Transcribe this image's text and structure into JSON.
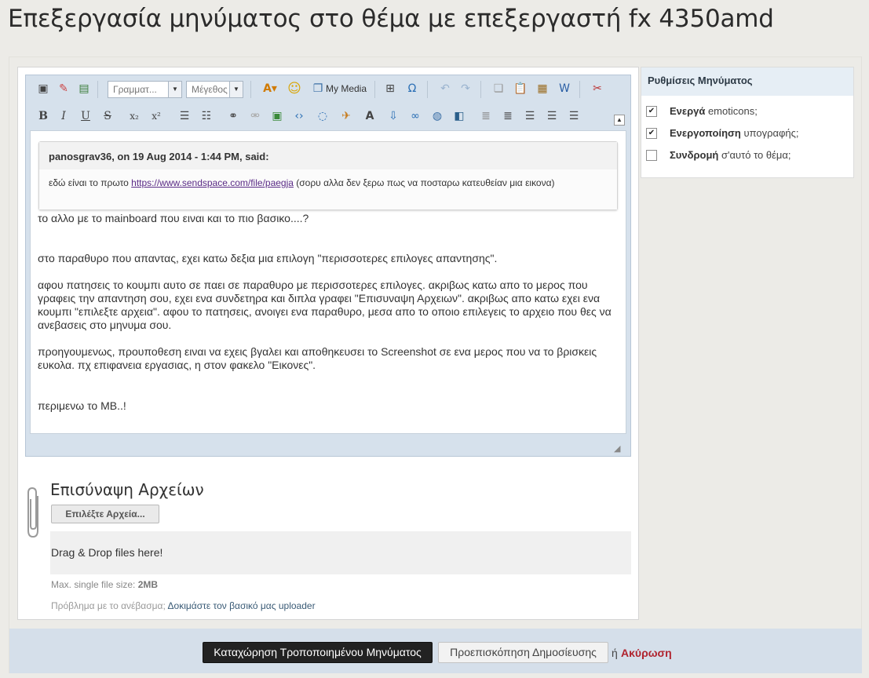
{
  "page": {
    "title": "Επεξεργασία μηνύματος στο θέμα με επεξεργαστή fx 4350amd"
  },
  "toolbar": {
    "font_select": "Γραμματ...",
    "size_select": "Μέγεθος",
    "my_media": "My Media",
    "row1_icons": [
      "source-icon",
      "eraser-icon",
      "toggle-editor-icon",
      "font-color-icon",
      "emoticon-icon",
      "media-icon",
      "table-icon",
      "special-char-icon",
      "undo-icon",
      "redo-icon",
      "copy-icon",
      "paste-icon",
      "paste-text-icon",
      "paste-word-icon",
      "remove-format-icon"
    ],
    "row2_icons": [
      "bold-icon",
      "italic-icon",
      "underline-icon",
      "strikethrough-icon",
      "subscript-icon",
      "superscript-icon",
      "bulleted-list-icon",
      "numbered-list-icon",
      "link-icon",
      "unlink-icon",
      "image-icon",
      "code-icon",
      "quote-icon",
      "spoiler-icon",
      "font-size-icon",
      "upload-icon",
      "url-icon",
      "web-icon",
      "media-embed-icon",
      "outdent-icon",
      "indent-icon",
      "align-left-icon",
      "align-center-icon",
      "align-right-icon"
    ]
  },
  "editor": {
    "quote_header": "panosgrav36, on 19 Aug 2014 - 1:44 PM, said:",
    "quote_text_before": "εδώ είναι το πρωτο ",
    "quote_link": "https://www.sendspace.com/file/paegja",
    "quote_text_after": "      (σορυ αλλα δεν ξερω πως να ποσταρω κατευθείαν μια εικονα)",
    "paragraphs": [
      "το αλλο με το mainboard που ειναι και το πιο βασικο....?",
      "στο παραθυρο που απαντας, εχει κατω δεξια μια επιλογη \"περισσοτερες επιλογες απαντησης\".",
      "αφου πατησεις το κουμπι αυτο σε παει σε παραθυρο με περισσοτερες επιλογες. ακριβως κατω απο το μερος που γραφεις την απαντηση σου, εχει ενα συνδετηρα και διπλα γραφει \"Επισυναψη Αρχειων\". ακριβως απο κατω εχει ενα κουμπι \"επιλεξτε αρχεια\". αφου το πατησεις, ανοιγει ενα παραθυρο, μεσα απο το οποιο επιλεγεις το αρχειο που θες να ανεβασεις στο μηνυμα σου.",
      "προηγουμενως, προυποθεση ειναι να εχεις βγαλει και αποθηκευσει το Screenshot σε ενα μερος που να το βρισκεις ευκολα. πχ επιφανεια εργασιας, η στον φακελο \"Εικονες\".",
      "περιμενω το MB..!"
    ]
  },
  "attachments": {
    "title": "Επισύναψη Αρχείων",
    "choose_button": "Επιλέξτε Αρχεία...",
    "dropzone": "Drag & Drop files here!",
    "max_label": "Max. single file size: ",
    "max_value": "2MB",
    "problem_text": "Πρόβλημα με το ανέβασμα; ",
    "problem_link": "Δοκιμάστε τον βασικό μας uploader"
  },
  "sidebar": {
    "title": "Ρυθμίσεις Μηνύματος",
    "options": [
      {
        "bold": "Ενεργά",
        "rest": " emoticons;",
        "checked": true
      },
      {
        "bold": "Ενεργοποίηση",
        "rest": " υπογραφής;",
        "checked": true
      },
      {
        "bold": "Συνδρομή",
        "rest": " σ'αυτό το θέμα;",
        "checked": false
      }
    ]
  },
  "footer": {
    "submit": "Καταχώρηση Τροποποιημένου Μηνύματος",
    "preview": "Προεπισκόπηση Δημοσίευσης",
    "or": "ή",
    "cancel": "Ακύρωση"
  }
}
